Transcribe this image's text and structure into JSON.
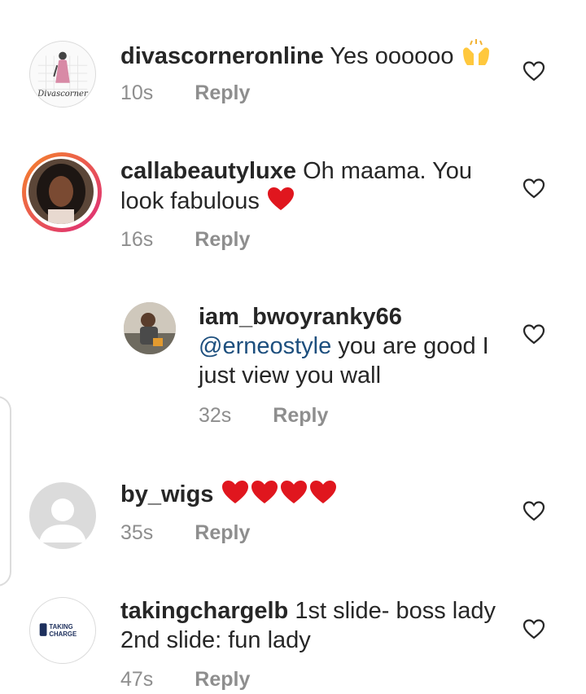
{
  "comments": [
    {
      "username": "divascorneronline",
      "body": "Yes oooooo",
      "emoji": "raising-hands",
      "time": "10s",
      "reply_label": "Reply",
      "avatar_text": "Divascorner"
    },
    {
      "username": "callabeautyluxe",
      "body": "Oh maama. You look fabulous",
      "emoji": "red-heart",
      "time": "16s",
      "reply_label": "Reply"
    },
    {
      "username": "iam_bwoyranky66",
      "mention": "@erneostyle",
      "body": "you are good I just view you wall",
      "time": "32s",
      "reply_label": "Reply"
    },
    {
      "username": "by_wigs",
      "emoji": "red-heart x4",
      "time": "35s",
      "reply_label": "Reply"
    },
    {
      "username": "takingchargelb",
      "body": "1st slide- boss lady 2nd slide: fun lady",
      "time": "47s",
      "reply_label": "Reply",
      "avatar_text_1": "TAKING",
      "avatar_text_2": "CHARGE"
    }
  ],
  "colors": {
    "text": "#262626",
    "meta": "#8e8e8e",
    "mention": "#1d4f7e",
    "heart_emoji": "#e0161e",
    "story_ring_start": "#f58529",
    "story_ring_end": "#dd2a7b"
  },
  "icons": {
    "like": "heart-outline-icon"
  }
}
